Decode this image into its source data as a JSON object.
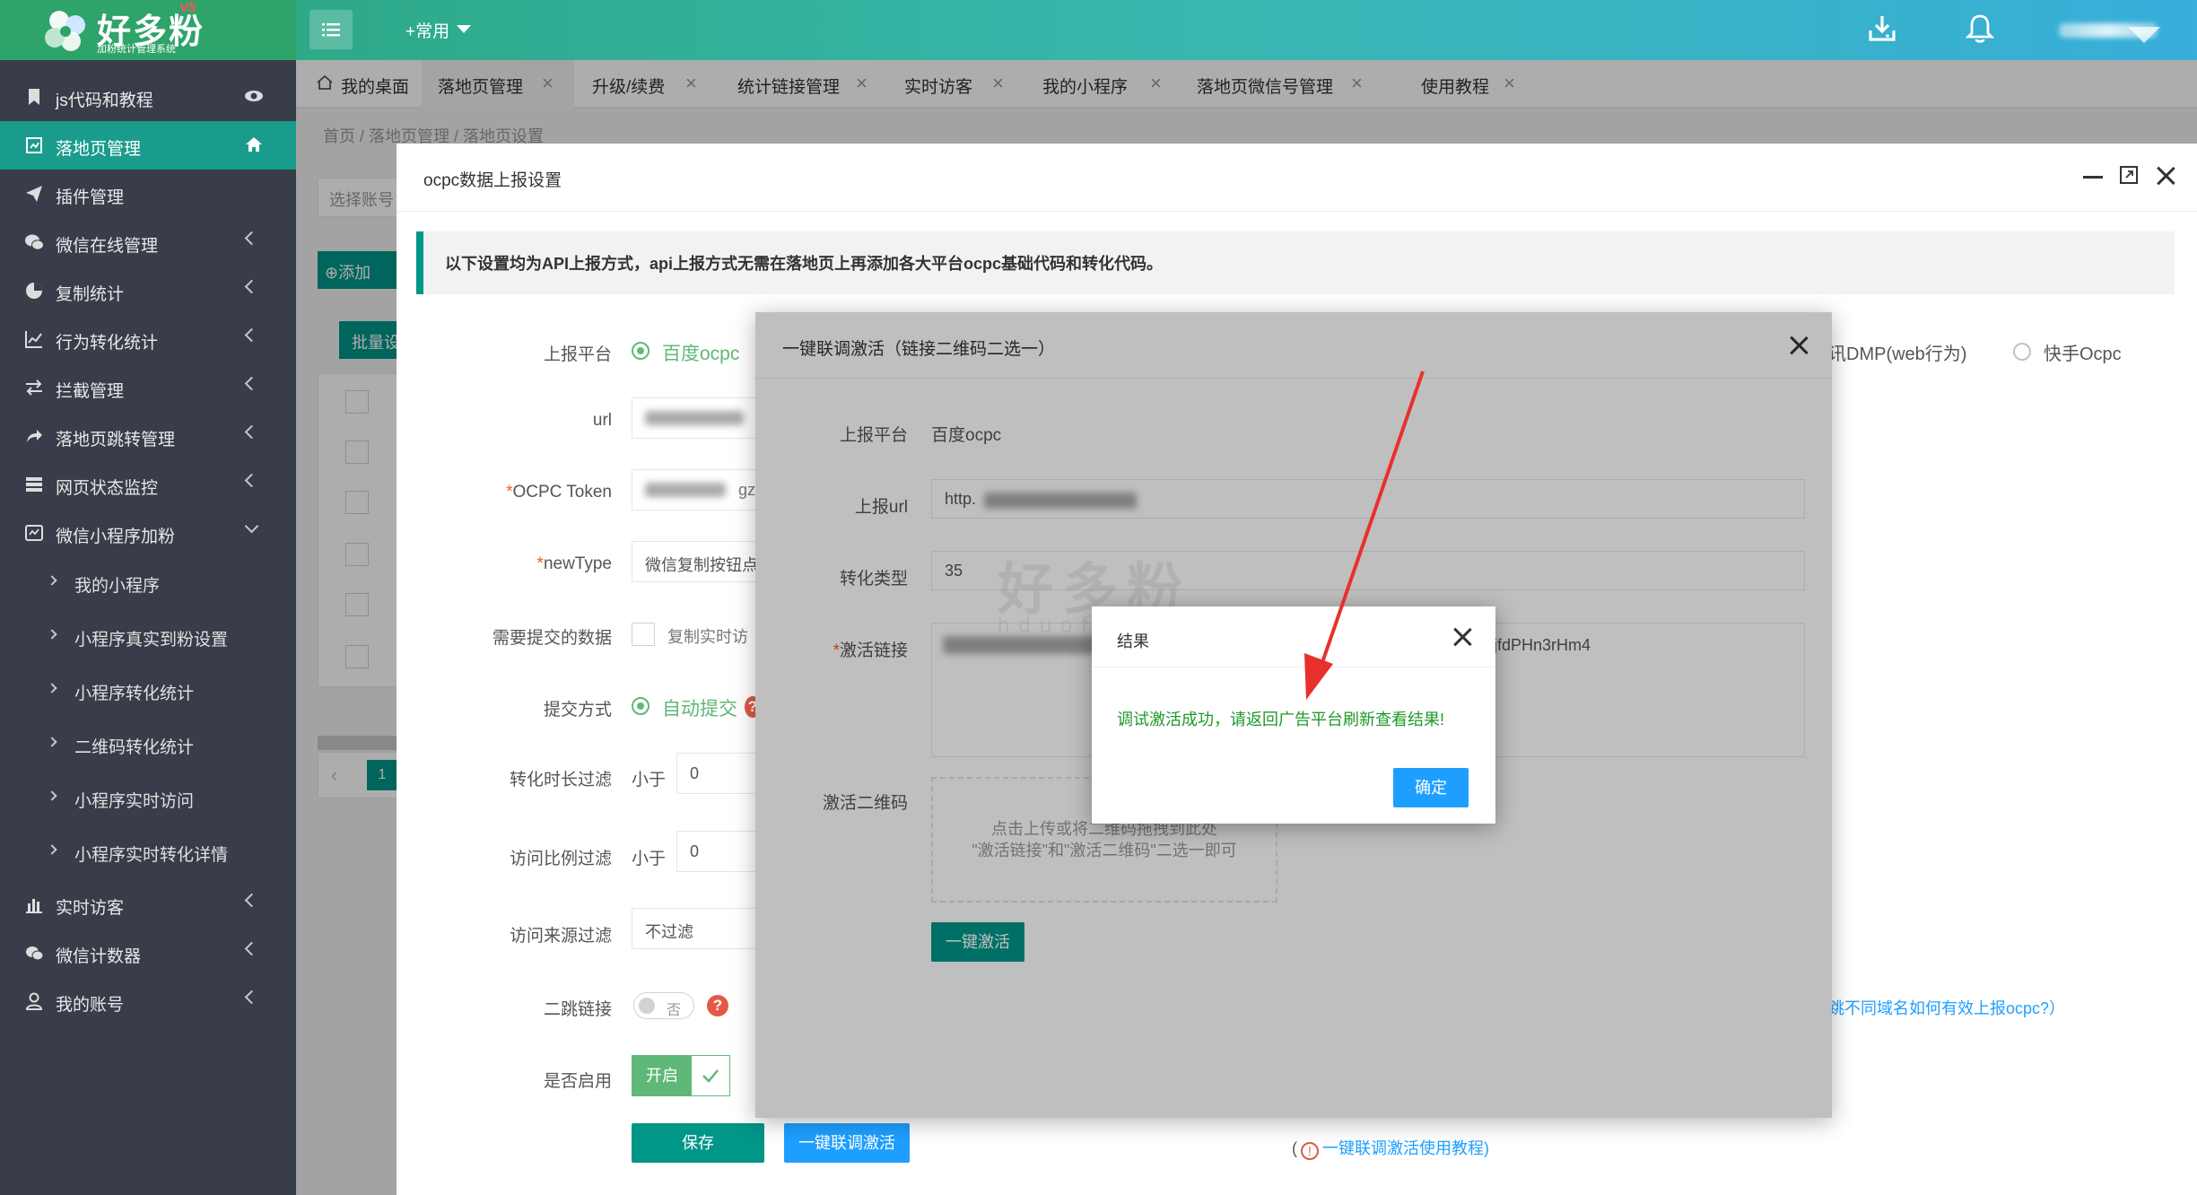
{
  "header": {
    "logo_name": "好多粉",
    "logo_version": "V5",
    "logo_subtitle": "加粉统计管理系统",
    "common_menu": "+常用"
  },
  "sidebar": {
    "items": [
      {
        "label": "js代码和教程",
        "icon": "bookmark-icon"
      },
      {
        "label": "落地页管理",
        "icon": "landing-page-icon",
        "active": true
      },
      {
        "label": "插件管理",
        "icon": "send-icon"
      },
      {
        "label": "微信在线管理",
        "icon": "wechat-icon"
      },
      {
        "label": "复制统计",
        "icon": "pie-chart-icon"
      },
      {
        "label": "行为转化统计",
        "icon": "line-chart-icon"
      },
      {
        "label": "拦截管理",
        "icon": "exchange-icon"
      },
      {
        "label": "落地页跳转管理",
        "icon": "share-icon"
      },
      {
        "label": "网页状态监控",
        "icon": "server-icon"
      },
      {
        "label": "微信小程序加粉",
        "icon": "mini-program-icon"
      }
    ],
    "sub_items": [
      "我的小程序",
      "小程序真实到粉设置",
      "小程序转化统计",
      "二维码转化统计",
      "小程序实时访问",
      "小程序实时转化详情"
    ],
    "bottom_items": [
      {
        "label": "实时访客",
        "icon": "bar-chart-icon"
      },
      {
        "label": "微信计数器",
        "icon": "chat-icon"
      },
      {
        "label": "我的账号",
        "icon": "user-icon"
      }
    ]
  },
  "tabs": [
    {
      "label": "我的桌面"
    },
    {
      "label": "落地页管理"
    },
    {
      "label": "升级/续费"
    },
    {
      "label": "统计链接管理"
    },
    {
      "label": "实时访客"
    },
    {
      "label": "我的小程序"
    },
    {
      "label": "落地页微信号管理"
    },
    {
      "label": "使用教程"
    }
  ],
  "breadcrumb": "首页  /  落地页管理  /  落地页设置",
  "background": {
    "select_account": "选择账号",
    "add_button": "添加",
    "batch_button": "批量设",
    "page_number": "1"
  },
  "ocpc_dialog": {
    "title": "ocpc数据上报设置",
    "notice": "以下设置均为API上报方式，api上报方式无需在落地页上再添加各大平台ocpc基础代码和转化代码。",
    "fields": {
      "platform_label": "上报平台",
      "platform_value": "百度ocpc",
      "platform_tencent": "讯DMP(web行为)",
      "platform_kuaishou": "快手Ocpc",
      "url_label": "url",
      "token_label": "OCPC Token",
      "token_fragment": "gz",
      "newtype_label": "newType",
      "newtype_value": "微信复制按钮点",
      "submit_data_label": "需要提交的数据",
      "submit_data_option": "复制实时访",
      "submit_mode_label": "提交方式",
      "submit_mode_value": "自动提交",
      "duration_filter_label": "转化时长过滤",
      "duration_filter_prefix": "小于",
      "duration_filter_value": "0",
      "ratio_filter_label": "访问比例过滤",
      "ratio_filter_prefix": "小于",
      "ratio_filter_value": "0",
      "source_filter_label": "访问来源过滤",
      "source_filter_value": "不过滤",
      "second_jump_label": "二跳链接",
      "second_jump_value": "否",
      "enable_label": "是否启用",
      "enable_value": "开启",
      "domain_hint": "跳不同域名如何有效上报ocpc?）",
      "tutorial_link": "一键联调激活使用教程)"
    },
    "save_button": "保存",
    "joint_button": "一键联调激活"
  },
  "activation_dialog": {
    "title": "一键联调激活（链接二维码二选一）",
    "platform_label": "上报平台",
    "platform_value": "百度ocpc",
    "url_label": "上报url",
    "url_value": "http.",
    "type_label": "转化类型",
    "type_value": "35",
    "link_label": "激活链接",
    "link_value_tail": "rnjfdPHn3rHm4",
    "qr_label": "激活二维码",
    "upload_line1": "点击上传或将二维码拖拽到此处",
    "upload_line2": "\"激活链接\"和\"激活二维码\"二选一即可",
    "activate_button": "一键激活"
  },
  "result_dialog": {
    "title": "结果",
    "message": "调试激活成功，请返回广告平台刷新查看结果!",
    "ok_button": "确定"
  },
  "watermark": {
    "text": "好多粉",
    "domain": "hduofen.com"
  },
  "colors": {
    "sidebar_bg": "#393d49",
    "active_teal": "#1a9c8c",
    "success_green": "#1f9a29",
    "ok_blue": "#1e9fff",
    "arrow_red": "#e8302c"
  }
}
